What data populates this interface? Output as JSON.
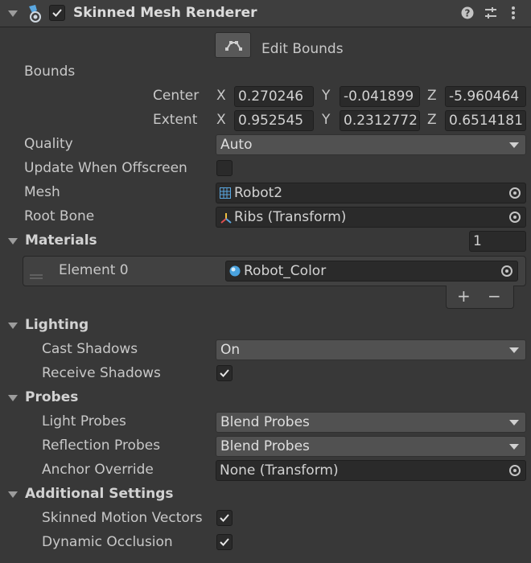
{
  "header": {
    "title": "Skinned Mesh Renderer",
    "enabled": true,
    "icons": [
      "skinned-mesh-icon",
      "help-icon",
      "presets-icon",
      "kebab-menu-icon"
    ]
  },
  "edit_bounds": {
    "label": "Edit Bounds"
  },
  "bounds": {
    "label": "Bounds",
    "center": {
      "label": "Center",
      "x_label": "X",
      "x": "0.270246",
      "y_label": "Y",
      "y": "-0.041899",
      "z_label": "Z",
      "z": "-5.960464"
    },
    "extent": {
      "label": "Extent",
      "x_label": "X",
      "x": "0.952545",
      "y_label": "Y",
      "y": "0.2312772",
      "z_label": "Z",
      "z": "0.6514181"
    }
  },
  "quality": {
    "label": "Quality",
    "value": "Auto"
  },
  "update_offscreen": {
    "label": "Update When Offscreen",
    "checked": false
  },
  "mesh": {
    "label": "Mesh",
    "value": "Robot2"
  },
  "root_bone": {
    "label": "Root Bone",
    "value": "Ribs (Transform)"
  },
  "materials": {
    "label": "Materials",
    "count": "1",
    "elements": [
      {
        "label": "Element 0",
        "value": "Robot_Color"
      }
    ],
    "add_label": "+",
    "remove_label": "−"
  },
  "lighting": {
    "label": "Lighting",
    "cast_shadows": {
      "label": "Cast Shadows",
      "value": "On"
    },
    "receive_shadows": {
      "label": "Receive Shadows",
      "checked": true
    }
  },
  "probes": {
    "label": "Probes",
    "light_probes": {
      "label": "Light Probes",
      "value": "Blend Probes"
    },
    "reflection_probes": {
      "label": "Reflection Probes",
      "value": "Blend Probes"
    },
    "anchor_override": {
      "label": "Anchor Override",
      "value": "None (Transform)"
    }
  },
  "additional": {
    "label": "Additional Settings",
    "skinned_motion_vectors": {
      "label": "Skinned Motion Vectors",
      "checked": true
    },
    "dynamic_occlusion": {
      "label": "Dynamic Occlusion",
      "checked": true
    }
  },
  "colors": {
    "background": "#383838",
    "field": "#2a2a2a",
    "dropdown": "#515151",
    "accent": "#4aa3df"
  }
}
